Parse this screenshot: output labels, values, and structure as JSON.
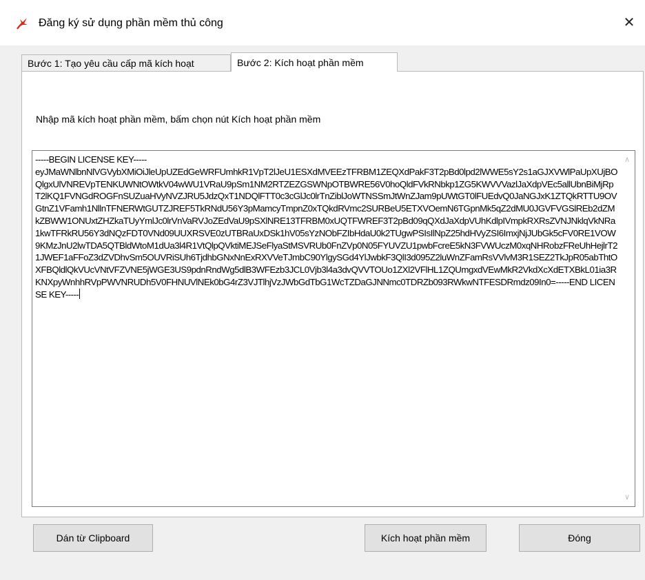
{
  "window": {
    "title": "Đăng ký sử dụng phần mềm thủ công",
    "close_glyph": "✕"
  },
  "tabs": [
    {
      "label": "Bước 1: Tạo yêu cầu cấp mã kích hoạt",
      "active": false
    },
    {
      "label": "Bước 2: Kích hoạt phần mềm",
      "active": true
    }
  ],
  "panel": {
    "instruction": "Nhập mã kích hoạt phần mềm, bấm chọn nút Kích hoạt phần mềm",
    "license_text": "-----BEGIN LICENSE KEY-----\neyJMaWNlbnNlVGVybXMiOiJleUpUZEdGeWRFUmhkR1VpT2lJeU1ESXdMVEEzTFRBM1ZEQXdPakF3T2pBd0lpd2lWWE5sY2s1aGJXVWlPaUpXUjBOQlgxUlVNREVpTENKUWNtOWtkV04wWU1VRaU9pSm1NM2RTZEZGSWNpOTBWRE56V0hoQldFVkRNbkp1ZG5KWVVVazlJaXdpVEc5allUbnBiMjRpT2lKQ1FVNGdROGFnSUZuaHVyNVZJRU5JdzQxT1NDQlFTT0c3cGlJc0lrTnZiblJoWTNSSmJtWnZJam9pUWtGT0lFUEdvQ0JaNGJxK1ZTQkRTTU9OVGtnZ1VFamh1NllnTFNERWtGUTZJREF5TkRNdU56Y3pMamcyTmpnZ0xTQkdRVmc2SURBeU5ETXVOemN6TGpnMk5qZ2dMU0JGVFVGSlREb2dZMkZBWW1ONUxtZHZkaTUyYmlJc0lrVnVaRVJoZEdVaU9pSXlNRE13TFRBM0xUQTFWREF3T2pBd09qQXdJaXdpVUhKdlpIVmpkRXRsZVNJNklqVkNRa1kwTFRkRU56Y3dNQzFDT0VNd09UUXRSVE0zUTBRaUxDSk1hV05sYzNObFZIbHdaU0k2TUgwPSIsIlNpZ25hdHVyZSI6ImxjNjJUbGk5cFV0RE1VOW9KMzJnU2lwTDA5QTBldWtoM1dUa3l4R1VtQlpQVktiMEJSeFlyaStMSVRUb0FnZVp0N05FYUVZU1pwbFcreE5kN3FVWUczM0xqNHRobzFReUhHejlrT21JWEF1aFFoZ3dZVDhvSm5OUVRiSUh6TjdhbGNxNnExRXVVeTJmbC90YlgySGd4YlJwbkF3QlI3d095Z2luWnZFamRsVVlvM3R1SEZ2TkJpR05abThtOXFBQldlQkVUcVNtVFZVNE5jWGE3US9pdnRndWg5dlB3WFEzb3JCL0Vjb3l4a3dvQVVTOUo1ZXl2VFlHL1ZQUmgxdVEwMkR2VkdXcXdETXBkL01ia3RKNXpyWnhhRVpPWVNRUDh5V0FHNUVlNEk0bG4rZ3VJTlhjVzJWbGdTbG1WcTZDaGJNNmc0TDRZb093RWkwNTFESDRmdz09In0=-----END LICENSE KEY-----",
    "scroll_up": "∧",
    "scroll_down": "∨"
  },
  "buttons": {
    "paste": "Dán từ Clipboard",
    "activate": "Kích hoạt phần mềm",
    "close": "Đóng"
  }
}
